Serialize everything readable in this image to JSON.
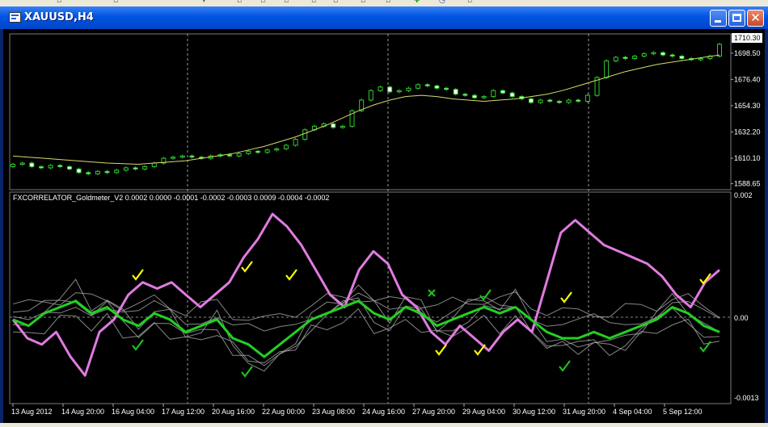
{
  "window": {
    "title": "XAUUSD,H4"
  },
  "toolbar": {
    "icons": [
      "toolbar-glyphs"
    ]
  },
  "indicator": {
    "label": "FXCORRELATOR_Goldmeter_V2 0.0002 0.0000 -0.0001 -0.0002 -0.0003 0.0009 -0.0004 -0.0002",
    "scale": [
      "0.002",
      "0.00",
      "-0.0013"
    ]
  },
  "colors": {
    "pink": "#e07be0",
    "green": "#22d022",
    "gray": "#a8a8a8",
    "ma": "#d9d96a",
    "checkGreen": "#1fbf1f",
    "checkYellow": "#ffff00"
  },
  "chart_data": {
    "type": "line",
    "symbol": "XAUUSD",
    "timeframe": "H4",
    "price_axis_labels": [
      "1710.30",
      "1698.50",
      "1676.40",
      "1654.30",
      "1632.20",
      "1610.10",
      "1588.65"
    ],
    "current_price": "1710.30",
    "time_labels": [
      "13 Aug 2012",
      "14 Aug 20:00",
      "16 Aug 04:00",
      "17 Aug 12:00",
      "20 Aug 16:00",
      "22 Aug 00:00",
      "23 Aug 08:00",
      "24 Aug 16:00",
      "27 Aug 20:00",
      "29 Aug 04:00",
      "30 Aug 12:00",
      "31 Aug 20:00",
      "4 Sep 04:00",
      "5 Sep 12:00"
    ],
    "price_ylim": [
      1587,
      1712
    ],
    "close_series": [
      1605,
      1606,
      1603,
      1602,
      1604,
      1603,
      1601,
      1598,
      1597,
      1599,
      1598,
      1600,
      1602,
      1601,
      1603,
      1606,
      1610,
      1611,
      1612,
      1611,
      1610,
      1612,
      1613,
      1612,
      1614,
      1616,
      1615,
      1617,
      1618,
      1621,
      1626,
      1634,
      1637,
      1639,
      1636,
      1637,
      1650,
      1659,
      1667,
      1670,
      1666,
      1667,
      1669,
      1672,
      1671,
      1669,
      1668,
      1664,
      1663,
      1661,
      1662,
      1667,
      1665,
      1662,
      1660,
      1657,
      1659,
      1658,
      1657,
      1659,
      1658,
      1663,
      1678,
      1692,
      1695,
      1694,
      1696,
      1698,
      1699,
      1697,
      1696,
      1694,
      1693,
      1694,
      1696,
      1706
    ],
    "ma_series": [
      1612,
      1611,
      1610,
      1609,
      1608,
      1607,
      1606,
      1605.5,
      1605,
      1606,
      1607,
      1608,
      1610,
      1612,
      1614,
      1617,
      1620,
      1624,
      1628,
      1633,
      1638,
      1644,
      1650,
      1655,
      1659,
      1662,
      1663,
      1662,
      1660,
      1659,
      1658,
      1659,
      1660,
      1662,
      1664,
      1667,
      1671,
      1675,
      1679,
      1683,
      1686,
      1689,
      1691,
      1693,
      1695,
      1697
    ],
    "indicator_ylim": [
      -0.0013,
      0.002
    ],
    "series": [
      {
        "values": [
          0.0,
          -0.0003,
          -0.0004,
          -0.0002,
          -0.0006,
          -0.0009,
          -0.0002,
          0.0,
          0.0004,
          0.0006,
          0.0005,
          0.0006,
          0.0004,
          0.0002,
          0.0004,
          0.0006,
          0.001,
          0.0013,
          0.0017,
          0.0015,
          0.0012,
          0.0008,
          0.0004,
          0.0002,
          0.0008,
          0.0011,
          0.0009,
          0.0004,
          0.0002,
          -0.0002,
          -0.0004,
          -0.0001,
          -0.0003,
          -0.0005,
          -0.0002,
          0.0,
          -0.0002,
          0.0006,
          0.0014,
          0.0016,
          0.0014,
          0.0012,
          0.0011,
          0.001,
          0.0009,
          0.0007,
          0.0004,
          0.0002,
          0.0006,
          0.0008
        ]
      },
      {
        "values": [
          0.0,
          -0.0001,
          0.0001,
          0.0002,
          0.0003,
          0.0001,
          0.0002,
          0.0,
          -0.0001,
          0.0001,
          0.0,
          -0.0002,
          -0.0001,
          0.0,
          -0.0003,
          -0.0004,
          -0.0006,
          -0.0004,
          -0.0002,
          0.0,
          0.0001,
          0.0002,
          0.0003,
          0.0001,
          0.0,
          0.0002,
          0.0001,
          -0.0001,
          0.0,
          0.0001,
          0.0002,
          0.0001,
          0.0002,
          0.0,
          -0.0002,
          -0.0003,
          -0.0003,
          -0.0002,
          -0.0003,
          -0.0002,
          -0.0001,
          0.0,
          0.0002,
          0.0001,
          -0.0001,
          -0.0002
        ]
      }
    ]
  }
}
